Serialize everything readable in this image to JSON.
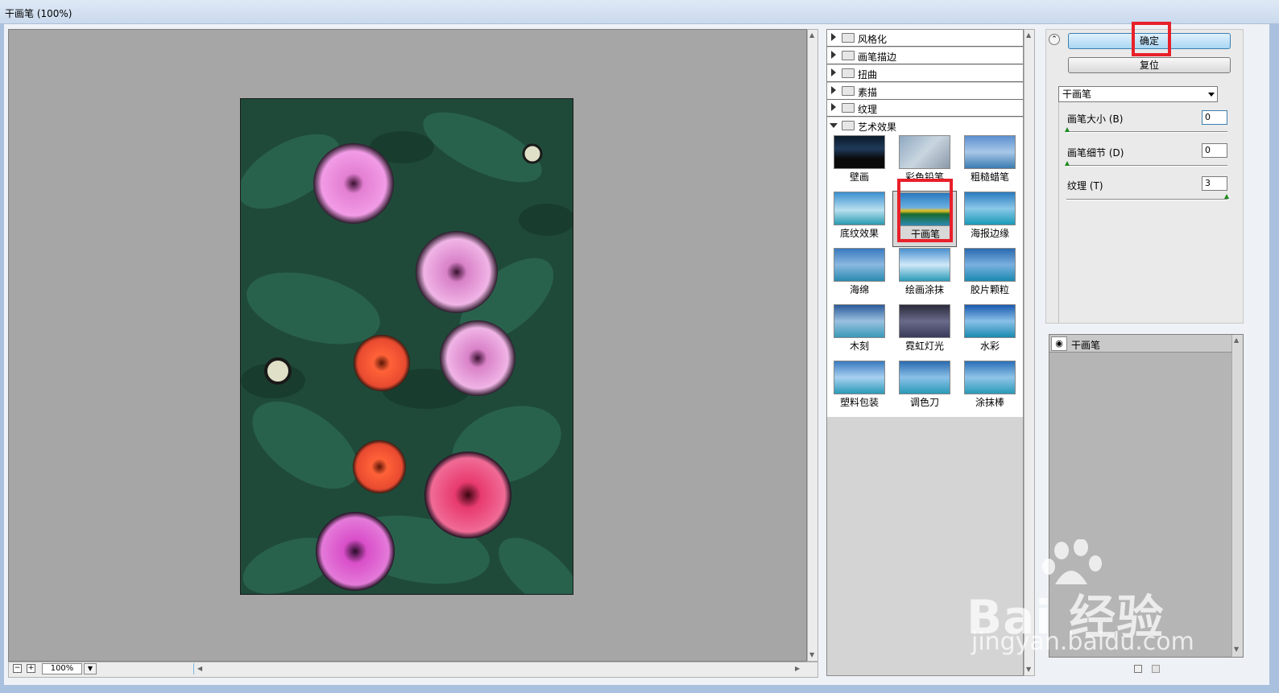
{
  "window": {
    "title": "干画笔 (100%)"
  },
  "canvas": {
    "zoom_label": "100%",
    "zoom_out": "−",
    "zoom_in": "+"
  },
  "filter_tree": {
    "folders": [
      {
        "label": "风格化",
        "open": false
      },
      {
        "label": "画笔描边",
        "open": false
      },
      {
        "label": "扭曲",
        "open": false
      },
      {
        "label": "素描",
        "open": false
      },
      {
        "label": "纹理",
        "open": false
      },
      {
        "label": "艺术效果",
        "open": true
      }
    ],
    "thumbnails": [
      {
        "label": "壁画"
      },
      {
        "label": "彩色铅笔"
      },
      {
        "label": "粗糙蜡笔"
      },
      {
        "label": "底纹效果"
      },
      {
        "label": "干画笔",
        "selected": true
      },
      {
        "label": "海报边缘"
      },
      {
        "label": "海绵"
      },
      {
        "label": "绘画涂抹"
      },
      {
        "label": "胶片颗粒"
      },
      {
        "label": "木刻"
      },
      {
        "label": "霓虹灯光"
      },
      {
        "label": "水彩"
      },
      {
        "label": "塑料包装"
      },
      {
        "label": "调色刀"
      },
      {
        "label": "涂抹棒"
      }
    ]
  },
  "controls": {
    "ok_label": "确定",
    "reset_label": "复位",
    "filter_selected": "干画笔",
    "params": [
      {
        "label": "画笔大小 (B)",
        "value": "0"
      },
      {
        "label": "画笔细节 (D)",
        "value": "0"
      },
      {
        "label": "纹理 (T)",
        "value": "3"
      }
    ]
  },
  "layers": {
    "items": [
      {
        "label": "干画笔"
      }
    ]
  },
  "watermark": {
    "text": "Bai 经验",
    "url": "jingyan.baidu.com"
  },
  "colors": {
    "highlight": "#e8202a",
    "ok_button": "#a9d6f3",
    "canvas_bg": "#a6a6a6"
  }
}
